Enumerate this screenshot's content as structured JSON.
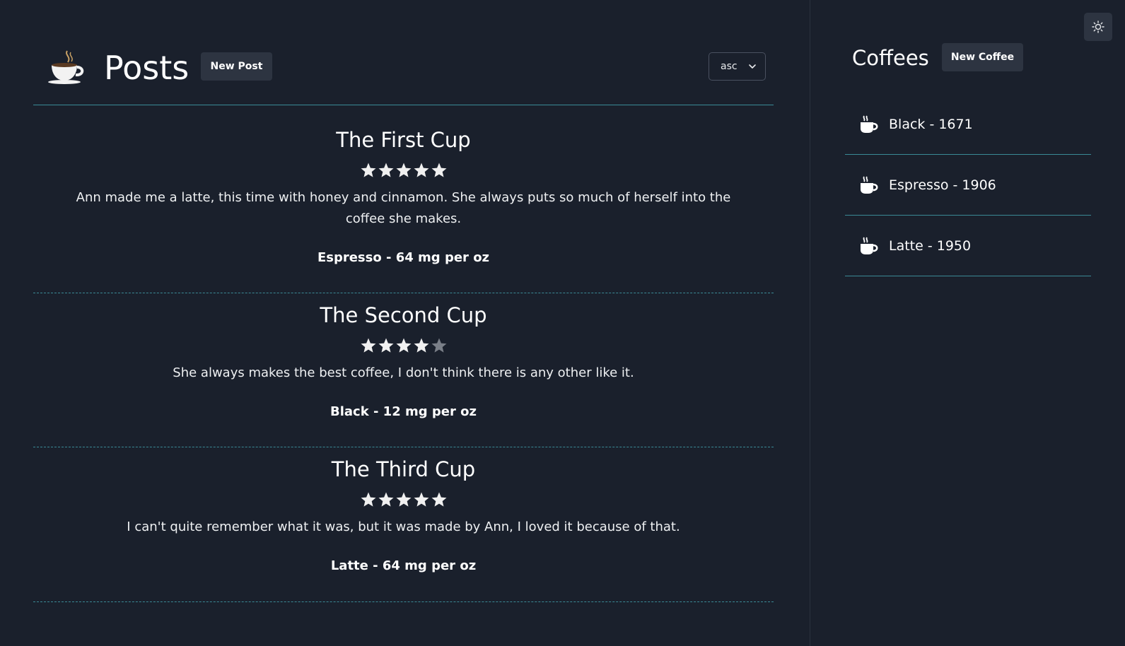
{
  "header": {
    "title": "Posts",
    "new_post_label": "New Post",
    "sort_value": "asc"
  },
  "posts": [
    {
      "title": "The First Cup",
      "rating": 5,
      "body": "Ann made me a latte, this time with honey and cinnamon. She always puts so much of herself into the coffee she makes.",
      "coffee": "Espresso - 64 mg per oz"
    },
    {
      "title": "The Second Cup",
      "rating": 4,
      "body": "She always makes the best coffee, I don't think there is any other like it.",
      "coffee": "Black - 12 mg per oz"
    },
    {
      "title": "The Third Cup",
      "rating": 5,
      "body": "I can't quite remember what it was, but it was made by Ann, I loved it because of that.",
      "coffee": "Latte - 64 mg per oz"
    }
  ],
  "sidebar": {
    "title": "Coffees",
    "new_coffee_label": "New Coffee",
    "items": [
      {
        "label": "Black -  1671"
      },
      {
        "label": "Espresso -  1906"
      },
      {
        "label": "Latte -  1950"
      }
    ]
  },
  "colors": {
    "background": "#1a202c",
    "accent": "#3a8a96",
    "button": "#2d3441"
  },
  "icons": {
    "logo": "coffee-cup-logo-icon",
    "star": "star-icon",
    "cup": "coffee-cup-icon",
    "theme": "sun-icon",
    "sort": "chevron-down-icon"
  }
}
